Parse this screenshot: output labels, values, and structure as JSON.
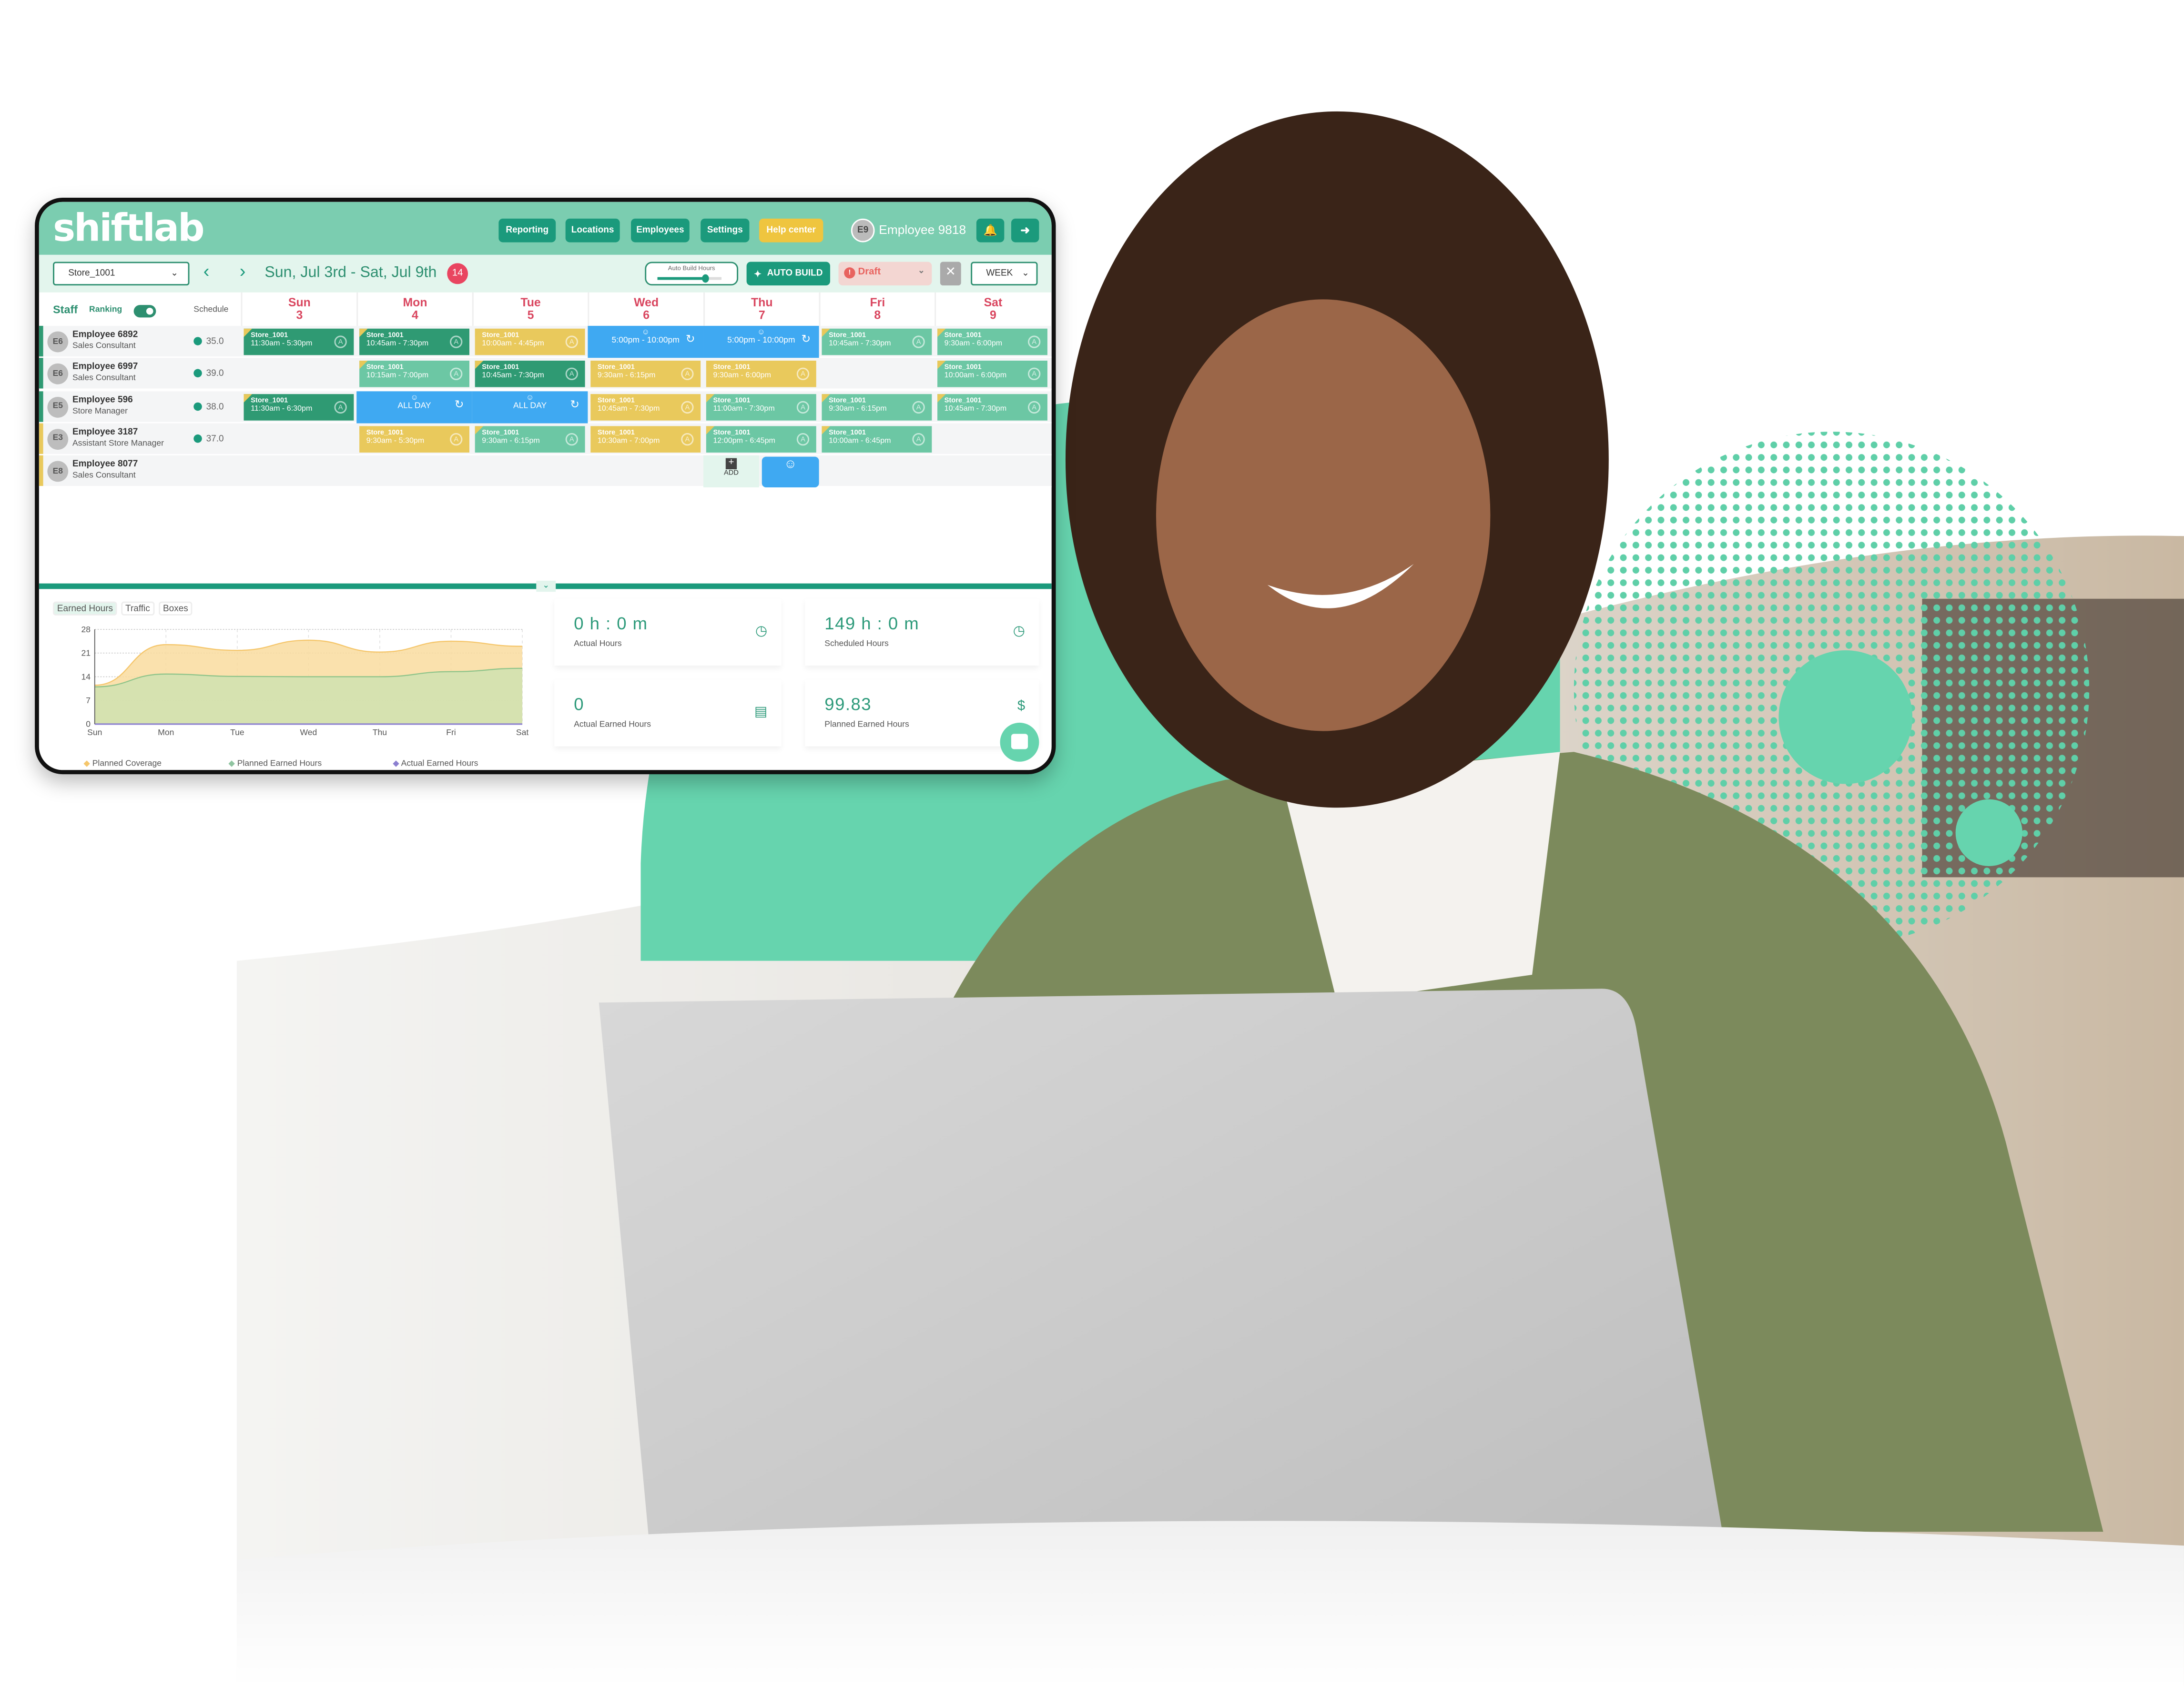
{
  "app": {
    "logo": "shiftlab"
  },
  "nav": {
    "items": [
      "Reporting",
      "Locations",
      "Employees",
      "Settings",
      "Help center"
    ],
    "user_initials": "E9",
    "user_name": "Employee 9818"
  },
  "toolbar": {
    "store": "Store_1001",
    "date_range": "Sun, Jul 3rd - Sat, Jul 9th",
    "badge": "14",
    "auto_build_hours_label": "Auto Build Hours",
    "auto_build_hours_level": 0.75,
    "auto_build": "AUTO BUILD",
    "status": "Draft",
    "view": "WEEK"
  },
  "grid": {
    "staff_label": "Staff",
    "ranking_label": "Ranking",
    "schedule_label": "Schedule",
    "days": [
      {
        "name": "Sun",
        "num": "3"
      },
      {
        "name": "Mon",
        "num": "4"
      },
      {
        "name": "Tue",
        "num": "5"
      },
      {
        "name": "Wed",
        "num": "6"
      },
      {
        "name": "Thu",
        "num": "7"
      },
      {
        "name": "Fri",
        "num": "8"
      },
      {
        "name": "Sat",
        "num": "9"
      }
    ],
    "colors": {
      "dg": "#2f9a73",
      "lg": "#6cc7a4",
      "y": "#e9c95c",
      "b": "#3fa9f2"
    },
    "employees": [
      {
        "initials": "E6",
        "name": "Employee 6892",
        "role": "Sales Consultant",
        "hours": "35.0",
        "bar": "#2f9a73",
        "shifts": [
          [
            "dg",
            "Store_1001",
            "11:30am - 5:30pm"
          ],
          [
            "dg",
            "Store_1001",
            "10:45am - 7:30pm"
          ],
          [
            "y",
            "Store_1001",
            "10:00am - 4:45pm"
          ],
          [
            "b",
            "",
            "5:00pm - 10:00pm"
          ],
          [
            "b",
            "",
            "5:00pm - 10:00pm"
          ],
          [
            "lg",
            "Store_1001",
            "10:45am - 7:30pm"
          ],
          [
            "lg",
            "Store_1001",
            "9:30am - 6:00pm"
          ]
        ]
      },
      {
        "initials": "E6",
        "name": "Employee 6997",
        "role": "Sales Consultant",
        "hours": "39.0",
        "bar": "#2f9a73",
        "shifts": [
          null,
          [
            "lg",
            "Store_1001",
            "10:15am - 7:00pm"
          ],
          [
            "dg",
            "Store_1001",
            "10:45am - 7:30pm"
          ],
          [
            "y",
            "Store_1001",
            "9:30am - 6:15pm"
          ],
          [
            "y",
            "Store_1001",
            "9:30am - 6:00pm"
          ],
          null,
          [
            "lg",
            "Store_1001",
            "10:00am - 6:00pm"
          ]
        ]
      },
      {
        "initials": "E5",
        "name": "Employee 596",
        "role": "Store Manager",
        "hours": "38.0",
        "bar": "#2f9a73",
        "shifts": [
          [
            "dg",
            "Store_1001",
            "11:30am - 6:30pm"
          ],
          [
            "b",
            "",
            "ALL DAY"
          ],
          [
            "b",
            "",
            "ALL DAY"
          ],
          [
            "y",
            "Store_1001",
            "10:45am - 7:30pm"
          ],
          [
            "lg",
            "Store_1001",
            "11:00am - 7:30pm"
          ],
          [
            "lg",
            "Store_1001",
            "9:30am - 6:15pm"
          ],
          [
            "lg",
            "Store_1001",
            "10:45am - 7:30pm"
          ]
        ]
      },
      {
        "initials": "E3",
        "name": "Employee 3187",
        "role": "Assistant Store Manager",
        "hours": "37.0",
        "bar": "#e9c95c",
        "shifts": [
          null,
          [
            "y",
            "Store_1001",
            "9:30am - 5:30pm"
          ],
          [
            "lg",
            "Store_1001",
            "9:30am - 6:15pm"
          ],
          [
            "y",
            "Store_1001",
            "10:30am - 7:00pm"
          ],
          [
            "lg",
            "Store_1001",
            "12:00pm - 6:45pm"
          ],
          [
            "lg",
            "Store_1001",
            "10:00am - 6:45pm"
          ],
          null
        ]
      },
      {
        "initials": "E8",
        "name": "Employee 8077",
        "role": "Sales Consultant",
        "hours": "",
        "bar": "#e9c95c",
        "shifts": [
          null,
          null,
          null,
          null,
          null,
          null,
          null
        ]
      }
    ],
    "add_label": "ADD"
  },
  "bottom": {
    "tabs": [
      "Earned Hours",
      "Traffic",
      "Boxes"
    ],
    "cards": [
      {
        "value": "0 h : 0 m",
        "label": "Actual Hours",
        "icon": "clock-icon"
      },
      {
        "value": "149 h : 0 m",
        "label": "Scheduled Hours",
        "icon": "clock-icon"
      },
      {
        "value": "0",
        "label": "Actual Earned Hours",
        "icon": "money-icon"
      },
      {
        "value": "99.83",
        "label": "Planned Earned Hours",
        "icon": "hand-dollar-icon"
      }
    ]
  },
  "chart_data": {
    "type": "area",
    "categories": [
      "Sun",
      "Mon",
      "Tue",
      "Wed",
      "Thu",
      "Fri",
      "Sat"
    ],
    "ylim": [
      0,
      28
    ],
    "yticks": [
      0,
      7,
      14,
      21,
      28
    ],
    "grid": true,
    "legend": "bottom",
    "series": [
      {
        "name": "Planned Coverage",
        "color": "#f5c66b",
        "values": [
          11.5,
          23.5,
          21.8,
          24.8,
          21.3,
          24.5,
          23.0
        ]
      },
      {
        "name": "Planned Earned Hours",
        "color": "#8fc48a",
        "values": [
          11.0,
          14.8,
          14.1,
          14.0,
          14.0,
          15.5,
          16.5
        ]
      },
      {
        "name": "Actual Earned Hours",
        "color": "#8b7fd0",
        "values": [
          0,
          0,
          0,
          0,
          0,
          0,
          0
        ]
      }
    ]
  }
}
